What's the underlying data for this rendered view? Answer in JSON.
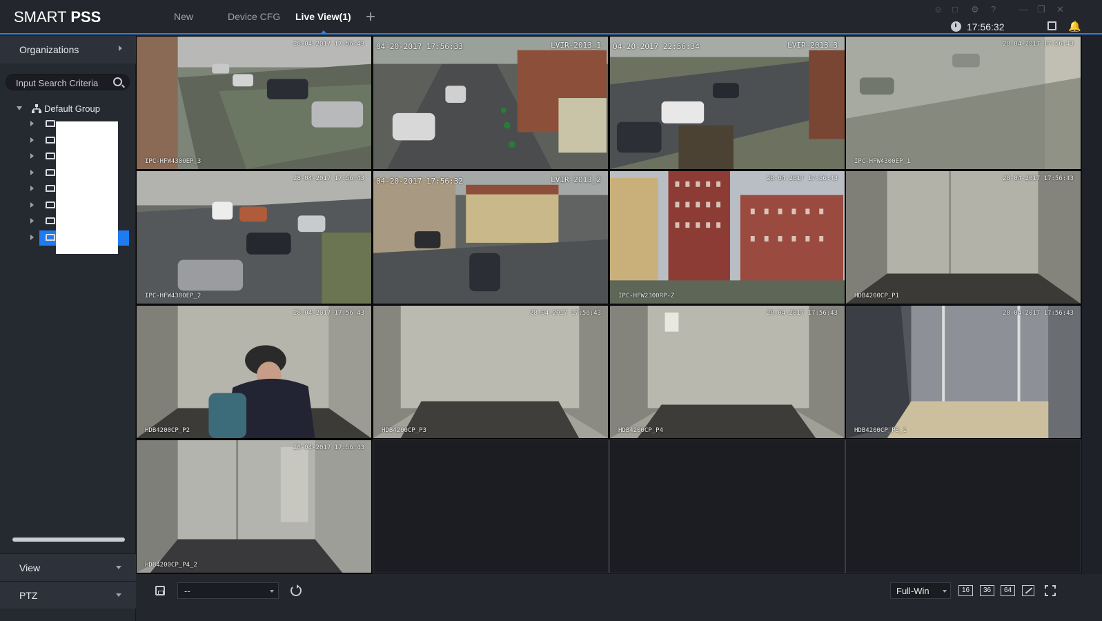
{
  "app": {
    "logo_thin": "SMART ",
    "logo_bold": "PSS"
  },
  "tabs": [
    {
      "label": "New",
      "active": false
    },
    {
      "label": "Device CFG",
      "active": false
    },
    {
      "label": "Live View(1)",
      "active": true
    }
  ],
  "add_tab_icon": "plus-icon",
  "system_icons": [
    "user-icon",
    "lock-icon",
    "gear-icon",
    "help-icon",
    "minimize-icon",
    "restore-icon",
    "close-icon"
  ],
  "clock": "17:56:32",
  "sidebar": {
    "organizations_label": "Organizations",
    "search_placeholder": "Input Search Criteria",
    "root_label": "Default Group",
    "device_count": 8,
    "selected_index": 7,
    "view_label": "View",
    "ptz_label": "PTZ"
  },
  "cells": [
    {
      "ts": "28-04-2017 17:56:43",
      "cam": "IPC-HFW4300EP_3",
      "scene": "yard-cars",
      "ts_style": "small"
    },
    {
      "ts": "04-20-2017 17:56:33",
      "cam": "",
      "scene": "street-green",
      "ts_style": "large",
      "ch": "LVIR-2013_1"
    },
    {
      "ts": "04-20-2017 22:56:34",
      "cam": "",
      "scene": "street-cars",
      "ts_style": "large",
      "ch": "LVIR-2013_3"
    },
    {
      "ts": "28-04-2017 17:56:43",
      "cam": "IPC-HFW4300EP_1",
      "scene": "foggy",
      "ts_style": "small"
    },
    {
      "ts": "28-04-2017 17:56:43",
      "cam": "IPC-HFW4300EP_2",
      "scene": "parking",
      "ts_style": "small"
    },
    {
      "ts": "04-20-2017 17:56:32",
      "cam": "",
      "scene": "courtyard",
      "ts_style": "large",
      "ch": "LVIR-2013_2"
    },
    {
      "ts": "28-04-2017 17:56:43",
      "cam": "IPC-HFW2300RP-Z",
      "scene": "buildings",
      "ts_style": "small"
    },
    {
      "ts": "28-04-2017 17:56:43",
      "cam": "HDB4200CP_P1",
      "scene": "elevator-empty",
      "ts_style": "small"
    },
    {
      "ts": "28-04-2017 17:56:43",
      "cam": "HDB4200CP_P2",
      "scene": "elevator-person",
      "ts_style": "small"
    },
    {
      "ts": "28-04-2017 17:56:43",
      "cam": "HDB4200CP_P3",
      "scene": "elevator-empty2",
      "ts_style": "small"
    },
    {
      "ts": "28-04-2017 17:56:43",
      "cam": "HDB4200CP_P4",
      "scene": "elevator-empty3",
      "ts_style": "small"
    },
    {
      "ts": "28-04-2017 17:56:43",
      "cam": "HDB4200CP_P3_1",
      "scene": "elevator-bright",
      "ts_style": "small"
    },
    {
      "ts": "28-04-2017 17:56:43",
      "cam": "HDB4200CP_P4_2",
      "scene": "elevator-panel",
      "ts_style": "small"
    },
    {
      "ts": "",
      "cam": "",
      "scene": "empty"
    },
    {
      "ts": "",
      "cam": "",
      "scene": "empty"
    },
    {
      "ts": "",
      "cam": "",
      "scene": "empty"
    }
  ],
  "bottombar": {
    "view_select_value": "--",
    "mode_select_value": "Full-Win",
    "split_labels": [
      "16",
      "36",
      "64"
    ]
  },
  "colors": {
    "accent": "#1f7bf2",
    "background": "#1e2128"
  }
}
